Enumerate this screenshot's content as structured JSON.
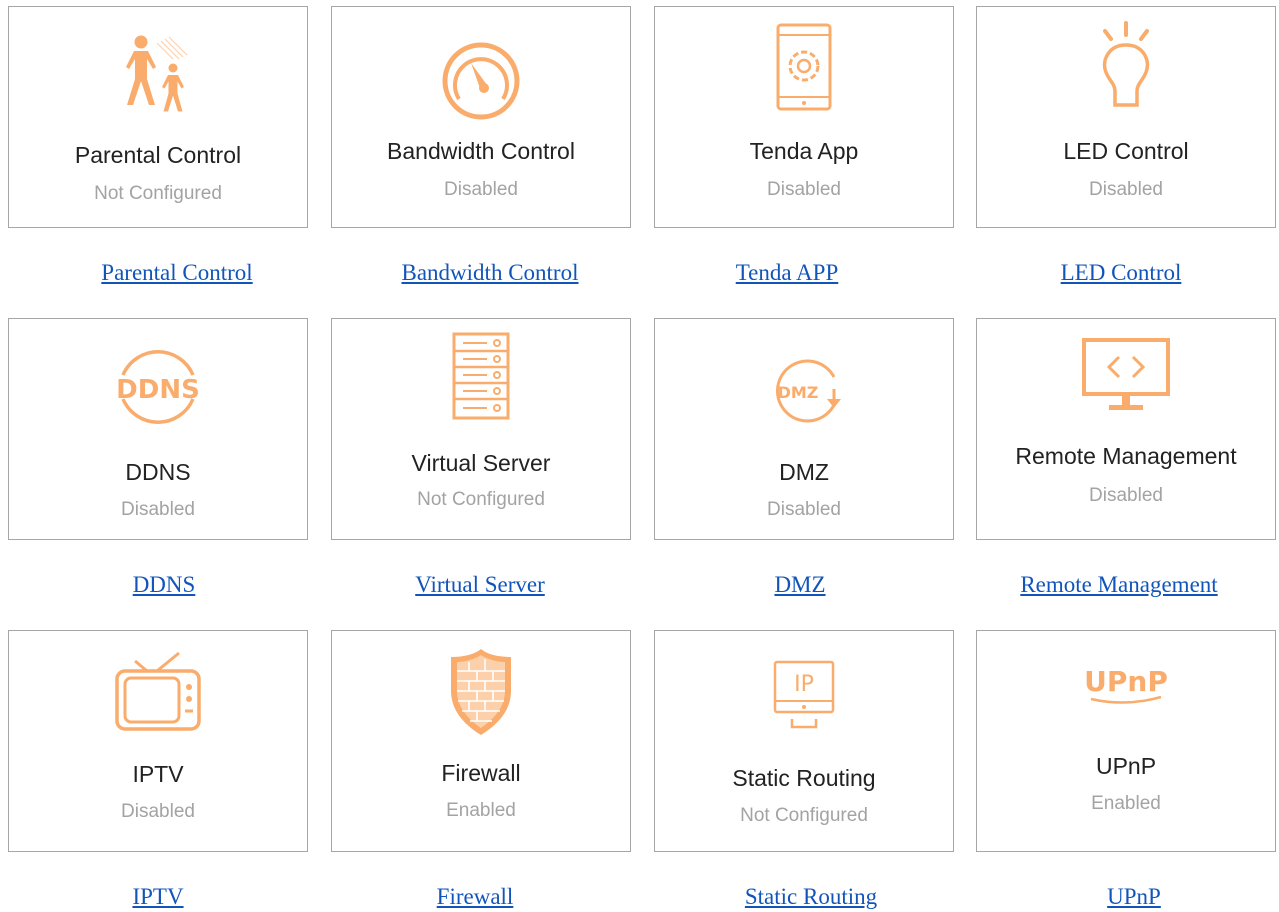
{
  "accent_color": "#f9ac6b",
  "tiles": [
    {
      "title": "Parental Control",
      "status": "Not Configured",
      "icon": "parent-child-icon",
      "link": "Parental Control"
    },
    {
      "title": "Bandwidth Control",
      "status": "Disabled",
      "icon": "speedometer-icon",
      "link": "Bandwidth Control"
    },
    {
      "title": "Tenda App",
      "status": "Disabled",
      "icon": "phone-gear-icon",
      "link": "Tenda APP"
    },
    {
      "title": "LED Control",
      "status": "Disabled",
      "icon": "lightbulb-icon",
      "link": "LED Control"
    },
    {
      "title": "DDNS",
      "status": "Disabled",
      "icon": "ddns-icon",
      "link": "DDNS",
      "icon_text": "DDNS"
    },
    {
      "title": "Virtual Server",
      "status": "Not Configured",
      "icon": "server-rack-icon",
      "link": "Virtual Server"
    },
    {
      "title": "DMZ",
      "status": "Disabled",
      "icon": "dmz-icon",
      "link": "DMZ",
      "icon_text": "DMZ"
    },
    {
      "title": "Remote Management",
      "status": "Disabled",
      "icon": "monitor-code-icon",
      "link": "Remote Management"
    },
    {
      "title": "IPTV",
      "status": "Disabled",
      "icon": "tv-icon",
      "link": "IPTV"
    },
    {
      "title": "Firewall",
      "status": "Enabled",
      "icon": "shield-brick-icon",
      "link": "Firewall"
    },
    {
      "title": "Static Routing",
      "status": "Not Configured",
      "icon": "monitor-ip-icon",
      "link": "Static Routing",
      "icon_text": "IP"
    },
    {
      "title": "UPnP",
      "status": "Enabled",
      "icon": "upnp-icon",
      "link": "UPnP",
      "icon_text": "UPnP"
    }
  ]
}
